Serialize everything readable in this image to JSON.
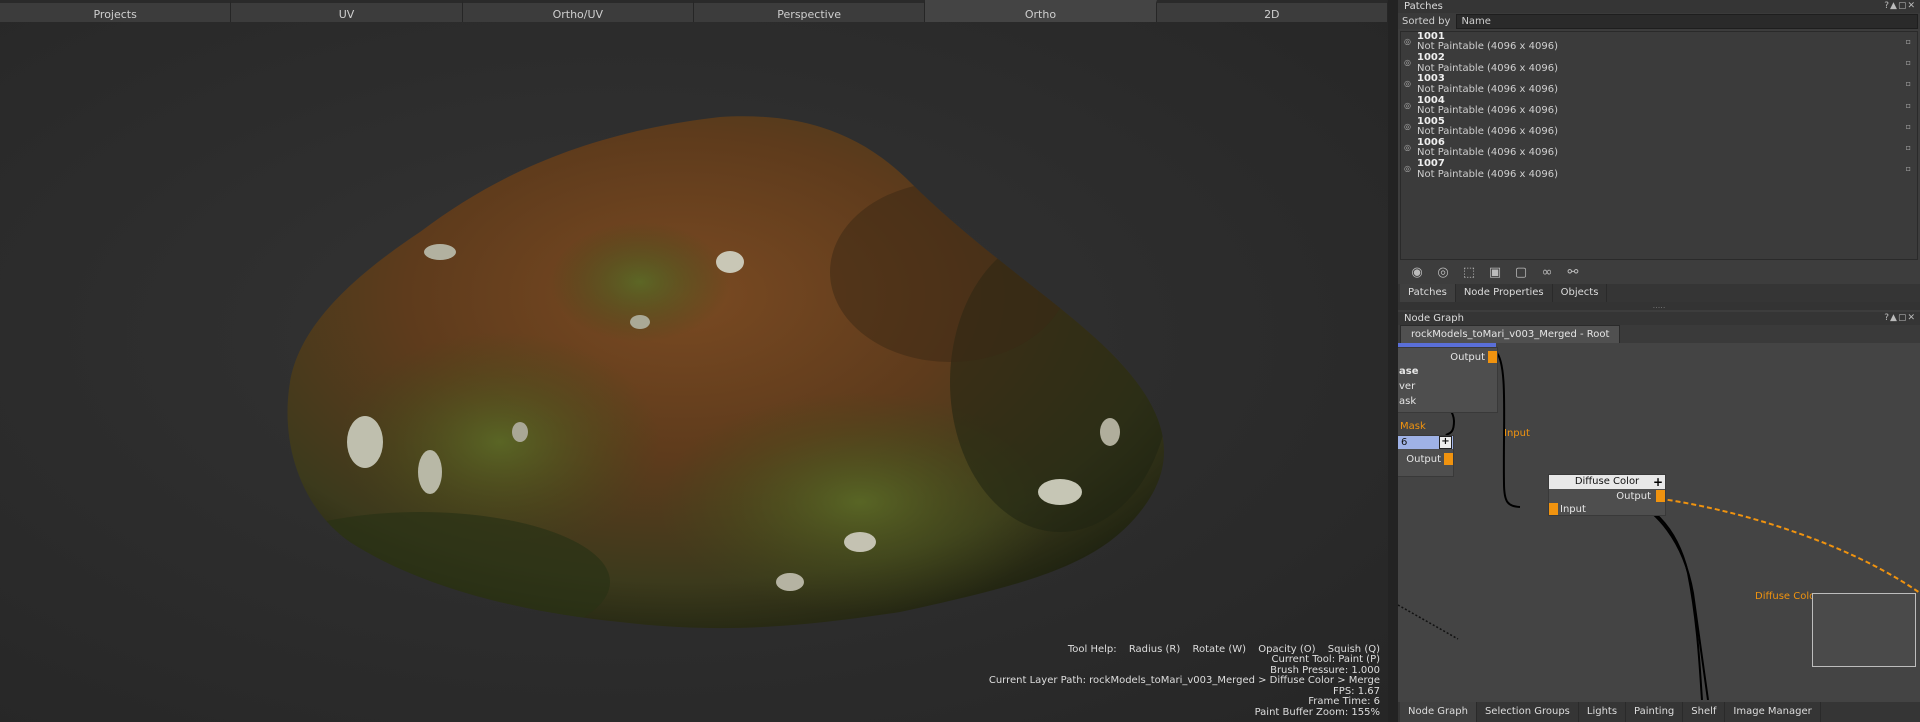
{
  "view_tabs": [
    "Projects",
    "UV",
    "Ortho/UV",
    "Perspective",
    "Ortho",
    "2D"
  ],
  "active_view_tab": "Ortho",
  "viewport_info": {
    "tool_help_label": "Tool Help:",
    "tool_help_items": [
      "Radius (R)",
      "Rotate (W)",
      "Opacity (O)",
      "Squish (Q)"
    ],
    "current_tool": "Current Tool: Paint (P)",
    "brush_pressure": "Brush Pressure: 1.000",
    "layer_path": "Current Layer Path: rockModels_toMari_v003_Merged > Diffuse Color > Merge",
    "fps": "FPS: 1.67",
    "frame_time": "Frame Time: 6",
    "zoom": "Paint Buffer Zoom: 155%"
  },
  "patches_panel": {
    "title": "Patches",
    "sorted_by_label": "Sorted by",
    "sorted_by_value": "Name",
    "patches": [
      {
        "id": "1001",
        "status": "Not Paintable (4096 x 4096)"
      },
      {
        "id": "1002",
        "status": "Not Paintable (4096 x 4096)"
      },
      {
        "id": "1003",
        "status": "Not Paintable (4096 x 4096)"
      },
      {
        "id": "1004",
        "status": "Not Paintable (4096 x 4096)"
      },
      {
        "id": "1005",
        "status": "Not Paintable (4096 x 4096)"
      },
      {
        "id": "1006",
        "status": "Not Paintable (4096 x 4096)"
      },
      {
        "id": "1007",
        "status": "Not Paintable (4096 x 4096)"
      }
    ],
    "icons": [
      "visibility-icon",
      "eye-icon",
      "select-icon",
      "lock-icon",
      "unlock-icon",
      "link-icon",
      "unlink-icon"
    ],
    "tabs": [
      "Patches",
      "Node Properties",
      "Objects"
    ]
  },
  "node_graph": {
    "title": "Node Graph",
    "tab": "rockModels_toMari_v003_Merged - Root",
    "node1": {
      "partial_labels": [
        "ase",
        "ver",
        "ask"
      ],
      "output": "Output"
    },
    "node2": {
      "mask_label": "Mask",
      "value": "6",
      "output": "Output"
    },
    "edge_input_label": "Input",
    "diffuse_node": {
      "title": "Diffuse Color",
      "output": "Output",
      "input": "Input"
    },
    "edge_diffuse_label": "Diffuse Color",
    "bottom_tabs": [
      "Node Graph",
      "Selection Groups",
      "Lights",
      "Painting",
      "Shelf",
      "Image Manager"
    ]
  },
  "colors": {
    "port": "#f0930f",
    "accent_bar": "#5a6fd8"
  }
}
